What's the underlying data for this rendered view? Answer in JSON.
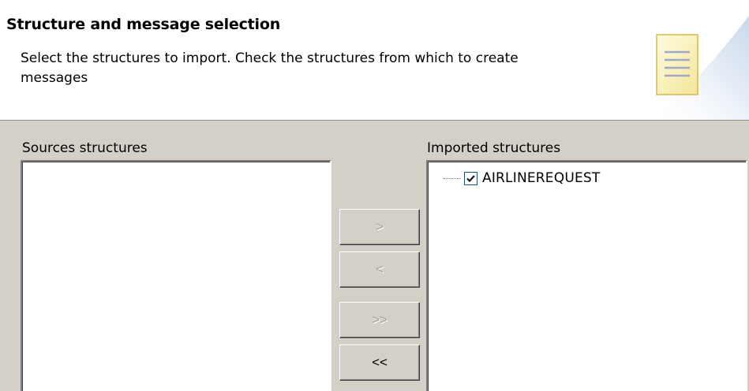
{
  "header": {
    "title": "Structure and message selection",
    "description": "Select the structures to import. Check the structures from which to create messages",
    "icon": "wizard-page-icon"
  },
  "sources": {
    "label": "Sources structures",
    "items": []
  },
  "imported": {
    "label": "Imported structures",
    "items": [
      {
        "label": "AIRLINEREQUEST",
        "checked": true
      }
    ]
  },
  "buttons": {
    "add": "&gt;",
    "remove": "&lt;",
    "add_all": "&gt;&gt;",
    "remove_all": "&lt;&lt;"
  },
  "colors": {
    "dialog_bg": "#d4d0c8",
    "header_bg": "#ffffff",
    "checkbox_border": "#1c5180",
    "checkmark": "#21a121"
  }
}
